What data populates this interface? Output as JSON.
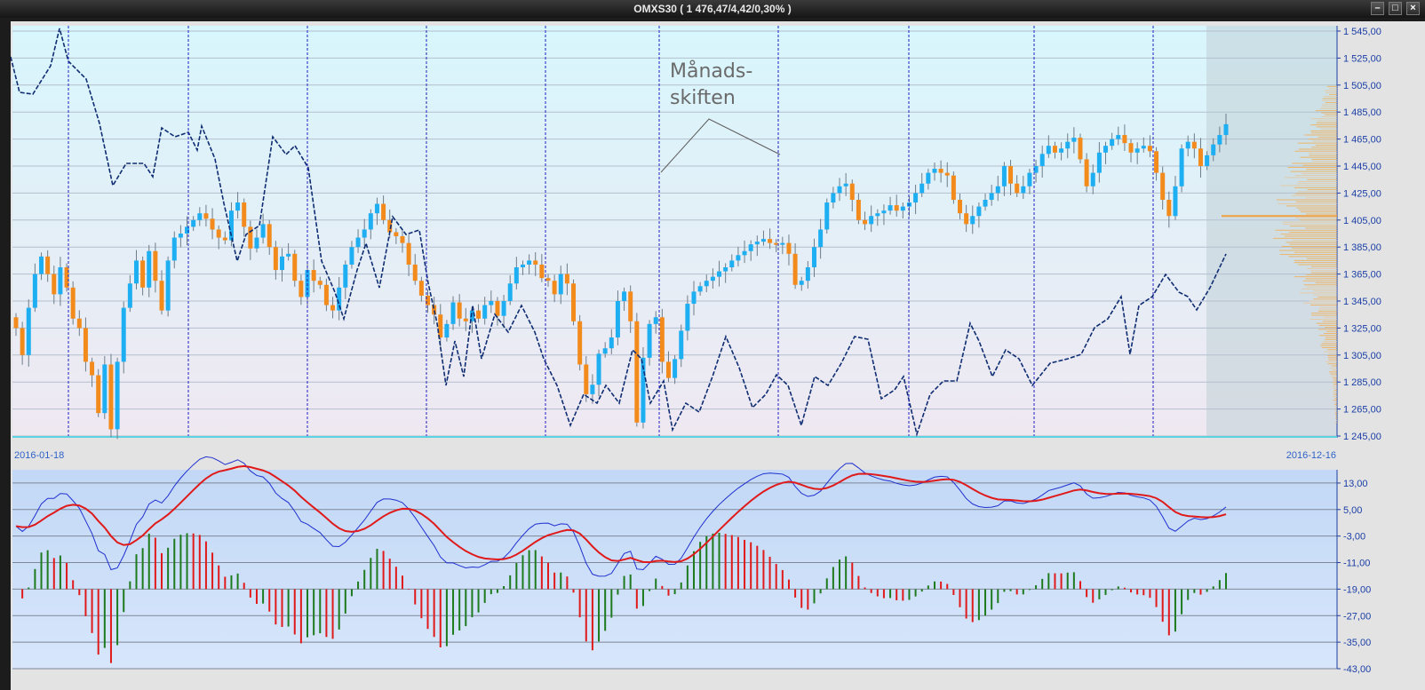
{
  "window": {
    "title": "OMXS30 ( 1 476,47/4,42/0,30% )"
  },
  "colors": {
    "up": "#1eaff2",
    "down": "#f38b1c",
    "macd_line": "#1f2fd0",
    "signal_line": "#e01a1a",
    "hist_pos": "#1d7a1d",
    "hist_neg": "#e01a1a",
    "month_lines": "#2020c0",
    "compare_line": "#0f2d72"
  },
  "chart_data": [
    {
      "type": "candlestick",
      "title": "OMXS30",
      "summary": "1 476,47/4,42/0,30%",
      "date_start": "2016-01-18",
      "date_end": "2016-12-16",
      "ylim": [
        1245,
        1545
      ],
      "yticks": [
        "1 245,00",
        "1 265,00",
        "1 285,00",
        "1 305,00",
        "1 325,00",
        "1 345,00",
        "1 365,00",
        "1 385,00",
        "1 405,00",
        "1 425,00",
        "1 445,00",
        "1 465,00",
        "1 485,00",
        "1 505,00",
        "1 525,00",
        "1 545,00"
      ],
      "ytick_values": [
        1245,
        1265,
        1285,
        1305,
        1325,
        1345,
        1365,
        1385,
        1405,
        1425,
        1445,
        1465,
        1485,
        1505,
        1525,
        1545
      ],
      "close": [
        1325,
        1305,
        1340,
        1365,
        1378,
        1365,
        1350,
        1370,
        1355,
        1332,
        1325,
        1300,
        1290,
        1262,
        1298,
        1250,
        1300,
        1340,
        1358,
        1375,
        1355,
        1382,
        1360,
        1338,
        1375,
        1392,
        1395,
        1400,
        1405,
        1410,
        1406,
        1398,
        1392,
        1390,
        1412,
        1418,
        1400,
        1384,
        1392,
        1402,
        1385,
        1368,
        1378,
        1380,
        1360,
        1348,
        1368,
        1360,
        1357,
        1342,
        1338,
        1355,
        1372,
        1385,
        1392,
        1398,
        1410,
        1417,
        1405,
        1396,
        1393,
        1388,
        1372,
        1360,
        1349,
        1342,
        1335,
        1318,
        1328,
        1344,
        1332,
        1330,
        1338,
        1332,
        1342,
        1345,
        1334,
        1345,
        1358,
        1370,
        1372,
        1375,
        1372,
        1362,
        1360,
        1350,
        1365,
        1358,
        1330,
        1298,
        1276,
        1283,
        1306,
        1310,
        1318,
        1345,
        1352,
        1330,
        1255,
        1303,
        1328,
        1333,
        1300,
        1288,
        1302,
        1323,
        1343,
        1352,
        1356,
        1360,
        1363,
        1367,
        1370,
        1375,
        1379,
        1382,
        1387,
        1389,
        1391,
        1388,
        1387,
        1388,
        1380,
        1357,
        1360,
        1370,
        1385,
        1398,
        1418,
        1425,
        1430,
        1432,
        1420,
        1405,
        1402,
        1408,
        1410,
        1412,
        1416,
        1412,
        1415,
        1418,
        1425,
        1432,
        1440,
        1443,
        1440,
        1438,
        1420,
        1410,
        1402,
        1408,
        1415,
        1420,
        1425,
        1430,
        1445,
        1432,
        1425,
        1430,
        1440,
        1445,
        1454,
        1460,
        1455,
        1458,
        1463,
        1466,
        1450,
        1430,
        1440,
        1455,
        1460,
        1465,
        1468,
        1462,
        1455,
        1458,
        1460,
        1456,
        1440,
        1420,
        1408,
        1430,
        1458,
        1463,
        1458,
        1445,
        1453,
        1461,
        1468,
        1476
      ],
      "volume_profile_present": true,
      "compare_line_note": "dashed comparison line (relative performance)",
      "annotations": [
        {
          "text_line1": "Månads-",
          "text_line2": "skiften"
        }
      ]
    },
    {
      "type": "macd",
      "ylim": [
        -43,
        17
      ],
      "yticks": [
        "13,00",
        "5,00",
        "-3,00",
        "-11,00",
        "-19,00",
        "-27,00",
        "-35,00",
        "-43,00"
      ],
      "ytick_values": [
        13,
        5,
        -3,
        -11,
        -19,
        -27,
        -35,
        -43
      ],
      "series": [
        {
          "name": "",
          "values_role": "macd_line"
        },
        {
          "name": "",
          "values_role": "signal_line"
        },
        {
          "name": "",
          "values_role": "histogram"
        }
      ]
    }
  ]
}
